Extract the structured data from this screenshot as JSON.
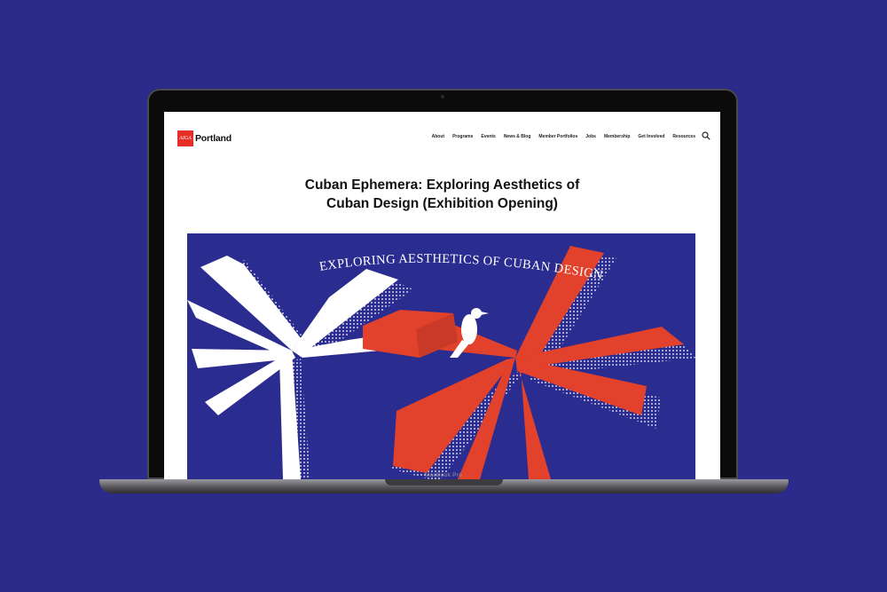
{
  "colors": {
    "background": "#2c2b8c",
    "logo_red": "#e62e27",
    "hero_blue": "#2b2c8f",
    "hero_red": "#e2412b",
    "hero_white": "#ffffff"
  },
  "site": {
    "logo_mark": "AIGA",
    "logo_name": "Portland"
  },
  "nav": {
    "items": [
      "About",
      "Programs",
      "Events",
      "News & Blog",
      "Member Portfolios",
      "Jobs",
      "Membership",
      "Get Involved",
      "Resources"
    ],
    "search_icon": "search-icon"
  },
  "page": {
    "title_line1": "Cuban Ephemera: Exploring Aesthetics of",
    "title_line2": "Cuban Design (Exhibition Opening)"
  },
  "hero": {
    "headline": "EXPLORING AESTHETICS OF CUBAN DESIGN"
  },
  "device": {
    "model_label": "MacBook Pro"
  }
}
